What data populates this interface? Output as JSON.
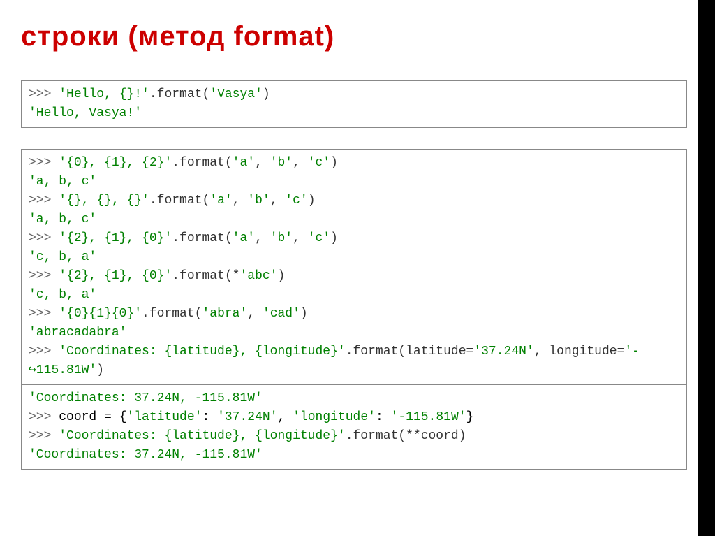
{
  "title": "строки (метод format)",
  "box1": {
    "line1_prompt": ">>> ",
    "line1_string": "'Hello, {}!'",
    "line1_method": ".format(",
    "line1_arg": "'Vasya'",
    "line1_close": ")",
    "line2": "'Hello, Vasya!'"
  },
  "box2": {
    "l1_prompt": ">>> ",
    "l1_str": "'{0}, {1}, {2}'",
    "l1_m": ".format(",
    "l1_a1": "'a'",
    "l1_c1": ", ",
    "l1_a2": "'b'",
    "l1_c2": ", ",
    "l1_a3": "'c'",
    "l1_close": ")",
    "l2": "'a, b, c'",
    "l3_prompt": ">>> ",
    "l3_str": "'{}, {}, {}'",
    "l3_m": ".format(",
    "l3_a1": "'a'",
    "l3_c1": ", ",
    "l3_a2": "'b'",
    "l3_c2": ", ",
    "l3_a3": "'c'",
    "l3_close": ")",
    "l4": "'a, b, c'",
    "l5_prompt": ">>> ",
    "l5_str": "'{2}, {1}, {0}'",
    "l5_m": ".format(",
    "l5_a1": "'a'",
    "l5_c1": ", ",
    "l5_a2": "'b'",
    "l5_c2": ", ",
    "l5_a3": "'c'",
    "l5_close": ")",
    "l6": "'c, b, a'",
    "l7_prompt": ">>> ",
    "l7_str": "'{2}, {1}, {0}'",
    "l7_m": ".format(*",
    "l7_a1": "'abc'",
    "l7_close": ")",
    "l8": "'c, b, a'",
    "l9_prompt": ">>> ",
    "l9_str": "'{0}{1}{0}'",
    "l9_m": ".format(",
    "l9_a1": "'abra'",
    "l9_c1": ", ",
    "l9_a2": "'cad'",
    "l9_close": ")",
    "l10": "'abracadabra'",
    "l11_prompt": ">>> ",
    "l11_str": "'Coordinates: {latitude}, {longitude}'",
    "l11_m": ".format(latitude=",
    "l11_a1": "'37.24N'",
    "l11_c1": ", longitude=",
    "l11_a2": "'-",
    "l12_arrow": "↪",
    "l12_a2b": "115.81W'",
    "l12_close": ")"
  },
  "box3": {
    "l1": "'Coordinates: 37.24N, -115.81W'",
    "l2_prompt": ">>> ",
    "l2_var": "coord = {",
    "l2_k1": "'latitude'",
    "l2_c1": ": ",
    "l2_v1": "'37.24N'",
    "l2_c2": ", ",
    "l2_k2": "'longitude'",
    "l2_c3": ": ",
    "l2_v2": "'-115.81W'",
    "l2_close": "}",
    "l3_prompt": ">>> ",
    "l3_str": "'Coordinates: {latitude}, {longitude}'",
    "l3_m": ".format(**coord)",
    "l4": "'Coordinates: 37.24N, -115.81W'"
  }
}
